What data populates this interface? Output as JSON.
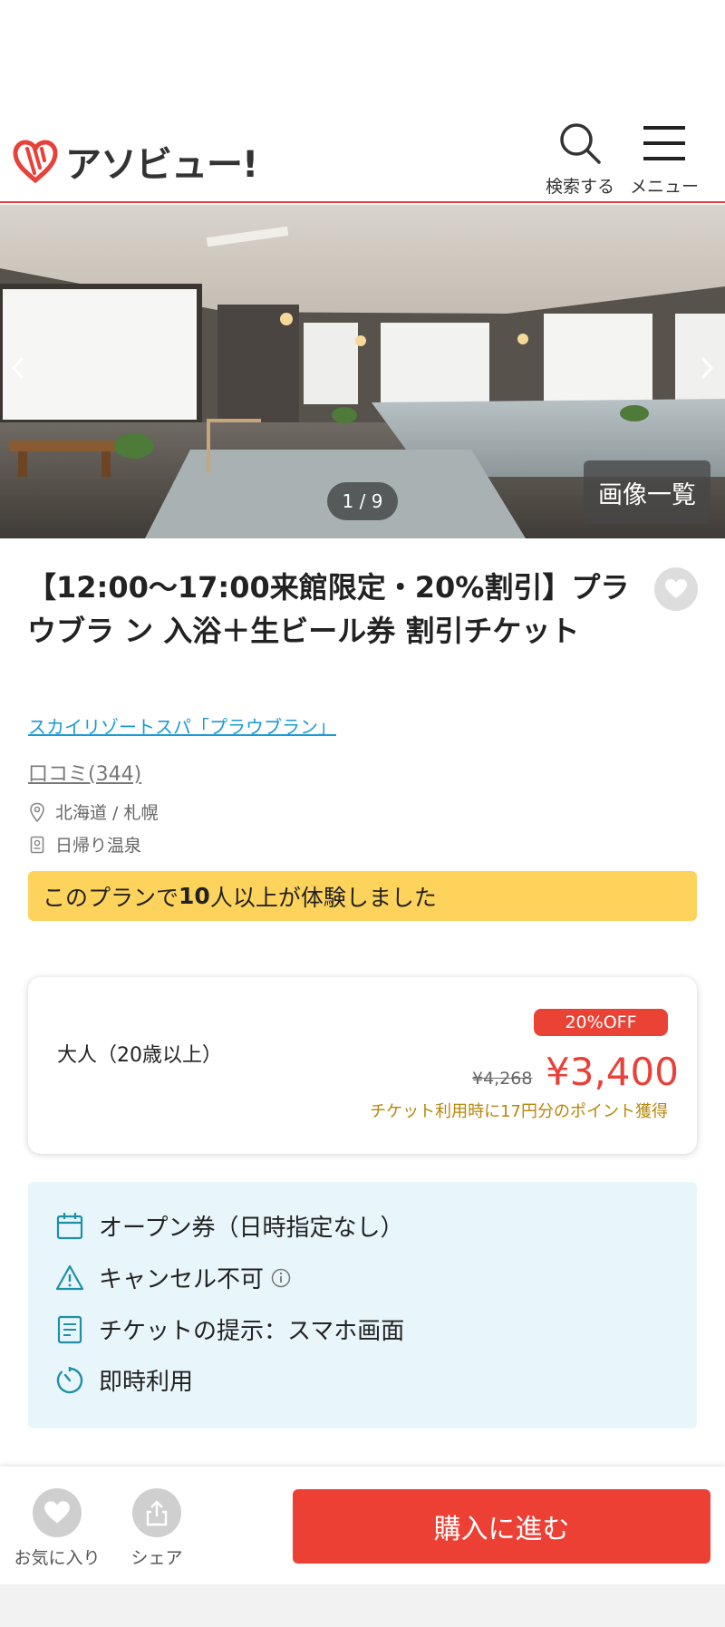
{
  "header": {
    "logo_text": "アソビュー!",
    "search_label": "検索する",
    "menu_label": "メニュー",
    "brand_color": "#e8413a"
  },
  "gallery": {
    "counter": "1 / 9",
    "list_button": "画像一覧",
    "prev_icon": "chevron-left-icon",
    "next_icon": "chevron-right-icon"
  },
  "product": {
    "title": "【12:00〜17:00来館限定・20%割引】プラウブラ ン 入浴＋生ビール券 割引チケット",
    "facility": "スカイリゾートスパ「プラウブラン」",
    "reviews": "口コミ(344)",
    "location": "北海道 / 札幌",
    "category": "日帰り温泉"
  },
  "banner": {
    "prefix": "このプランで",
    "highlight": "10",
    "suffix": "人以上が体験しました",
    "color": "#fdd35c"
  },
  "price": {
    "age_label": "大人（20歳以上）",
    "discount_badge": "20%OFF",
    "original_price": "¥4,268",
    "sale_price": "¥3,400",
    "points_note": "チケット利用時に17円分のポイント獲得"
  },
  "info": {
    "items": [
      {
        "icon": "calendar-icon",
        "text": "オープン券（日時指定なし）"
      },
      {
        "icon": "warning-icon",
        "text": "キャンセル不可"
      },
      {
        "icon": "document-icon",
        "text": "チケットの提示：スマホ画面"
      },
      {
        "icon": "timer-icon",
        "text": "即時利用"
      }
    ]
  },
  "bottom_bar": {
    "favorite_label": "お気に入り",
    "share_label": "シェア",
    "buy_label": "購入に進む",
    "buy_color": "#ec4035"
  }
}
